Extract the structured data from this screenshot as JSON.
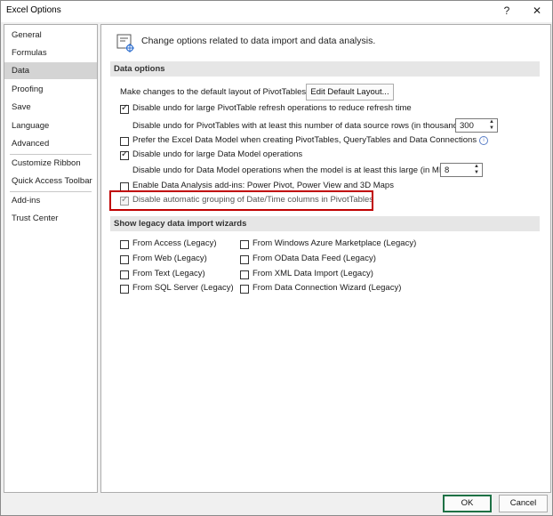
{
  "window": {
    "title": "Excel Options",
    "help_label": "?",
    "close_label": "✕"
  },
  "sidebar": {
    "items": [
      {
        "label": "General"
      },
      {
        "label": "Formulas"
      },
      {
        "label": "Data"
      },
      {
        "label": "Proofing"
      },
      {
        "label": "Save"
      },
      {
        "label": "Language"
      },
      {
        "label": "Advanced"
      },
      {
        "label": "Customize Ribbon"
      },
      {
        "label": "Quick Access Toolbar"
      },
      {
        "label": "Add-ins"
      },
      {
        "label": "Trust Center"
      }
    ],
    "selected": "Data"
  },
  "header": {
    "text": "Change options related to data import and data analysis.",
    "icon": "data-options-icon"
  },
  "data_options": {
    "title": "Data options",
    "default_layout_label": "Make changes to the default layout of PivotTables:",
    "edit_layout_button": "Edit Default Layout...",
    "opt_disable_undo_pivot": {
      "label": "Disable undo for large PivotTable refresh operations to reduce refresh time",
      "checked": true
    },
    "undo_rows_label": "Disable undo for PivotTables with at least this number of data source rows (in thousands):",
    "undo_rows_value": "300",
    "opt_prefer_data_model": {
      "label": "Prefer the Excel Data Model when creating PivotTables, QueryTables and Data Connections",
      "checked": false
    },
    "opt_disable_undo_model": {
      "label": "Disable undo for large Data Model operations",
      "checked": true
    },
    "undo_model_label": "Disable undo for Data Model operations when the model is at least this large (in MB):",
    "undo_model_value": "8",
    "opt_enable_addins": {
      "label": "Enable Data Analysis add-ins: Power Pivot, Power View and 3D Maps",
      "checked": false
    },
    "opt_disable_grouping": {
      "label": "Disable automatic grouping of Date/Time columns in PivotTables",
      "checked": true
    }
  },
  "legacy": {
    "title": "Show legacy data import wizards",
    "left": [
      {
        "label": "From Access (Legacy)"
      },
      {
        "label": "From Web (Legacy)"
      },
      {
        "label": "From Text (Legacy)"
      },
      {
        "label": "From SQL Server (Legacy)"
      }
    ],
    "right": [
      {
        "label": "From Windows Azure Marketplace (Legacy)"
      },
      {
        "label": "From OData Data Feed (Legacy)"
      },
      {
        "label": "From XML Data Import (Legacy)"
      },
      {
        "label": "From Data Connection Wizard (Legacy)"
      }
    ]
  },
  "footer": {
    "ok": "OK",
    "cancel": "Cancel"
  },
  "colors": {
    "highlight": "#c00000",
    "ok_border": "#1e7145",
    "selected_nav": "#d4d4d4"
  }
}
